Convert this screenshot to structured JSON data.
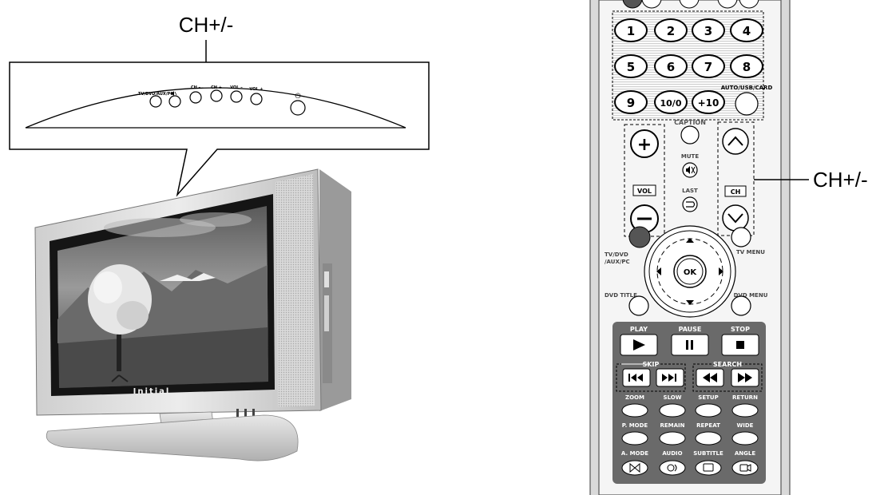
{
  "callouts": {
    "tv_label": "CH+/-",
    "remote_label": "CH+/-"
  },
  "tv_panel": {
    "buttons": [
      "TV/DVD/AUX/PC",
      "",
      "CH –",
      "CH +",
      "VOL –",
      "VOL +"
    ],
    "power_symbol": "⏻"
  },
  "tv": {
    "brand": "Initial"
  },
  "remote": {
    "numbers": [
      "1",
      "2",
      "3",
      "4",
      "5",
      "6",
      "7",
      "8",
      "9",
      "10/0",
      "+10"
    ],
    "auto_usb_card": "AUTO/USB/CARD",
    "caption": "CAPTION",
    "mute": "MUTE",
    "last": "LAST",
    "vol": "VOL",
    "ch": "CH",
    "tv_dvd": "TV/DVD",
    "aux_pc": "/AUX/PC",
    "tv_menu": "TV MENU",
    "ok": "OK",
    "dvd_title": "DVD TITLE",
    "dvd_menu": "DVD MENU",
    "play": "PLAY",
    "pause": "PAUSE",
    "stop": "STOP",
    "skip": "SKIP",
    "search": "SEARCH",
    "row1": [
      "ZOOM",
      "SLOW",
      "SETUP",
      "RETURN"
    ],
    "row2": [
      "P. MODE",
      "REMAIN",
      "REPEAT",
      "WIDE"
    ],
    "row3": [
      "A. MODE",
      "AUDIO",
      "SUBTITLE",
      "ANGLE"
    ]
  }
}
